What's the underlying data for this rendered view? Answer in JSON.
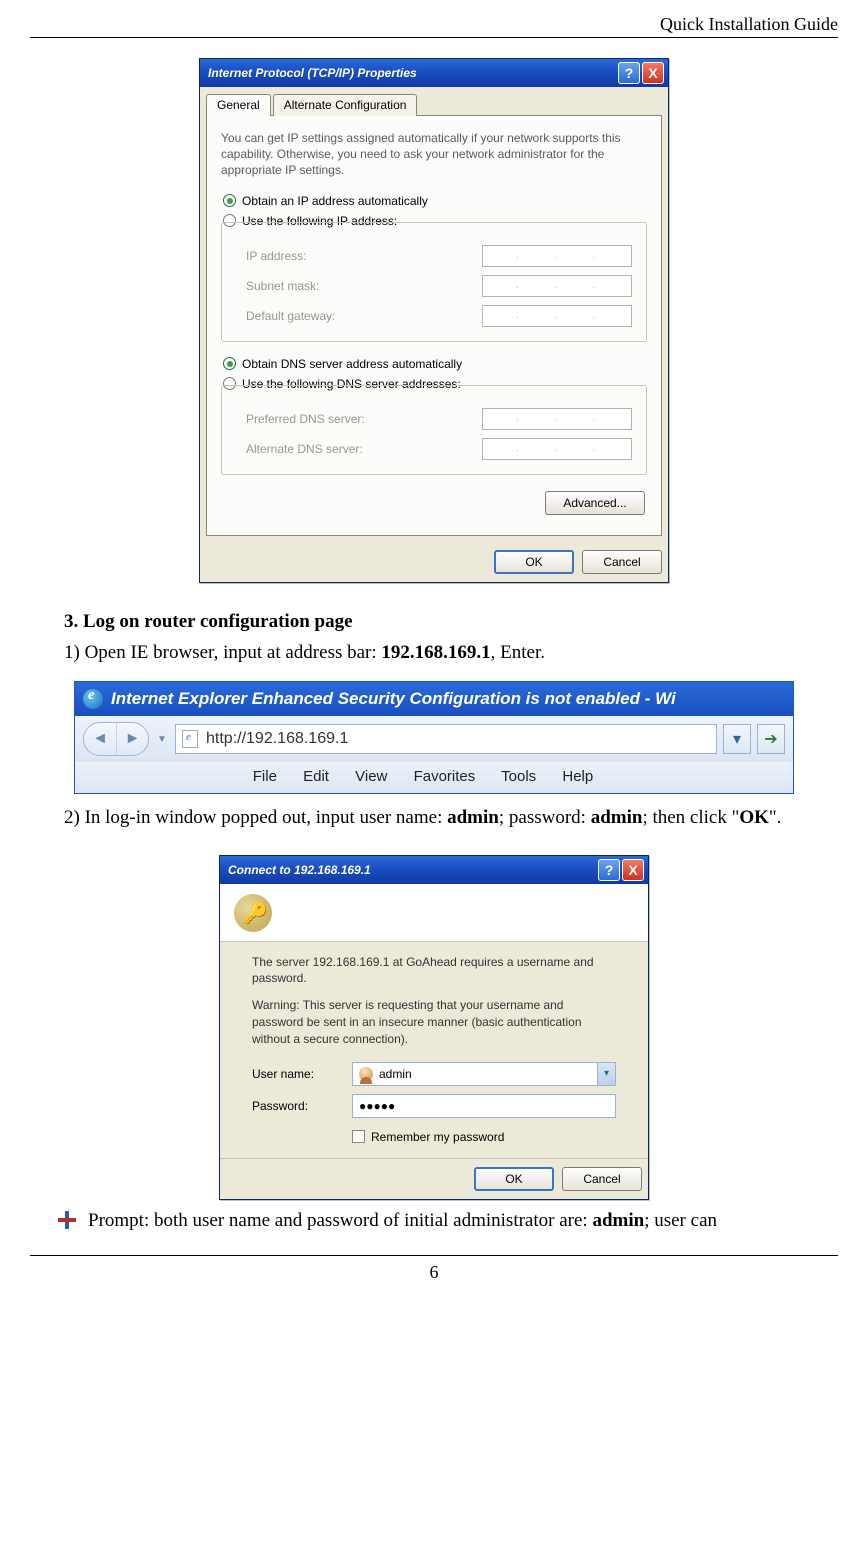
{
  "doc": {
    "header": "Quick Installation Guide",
    "page_number": "6"
  },
  "tcpip_dialog": {
    "title": "Internet Protocol (TCP/IP) Properties",
    "help_btn": "?",
    "close_btn": "X",
    "tabs": {
      "general": "General",
      "alt": "Alternate Configuration"
    },
    "description": "You can get IP settings assigned automatically if your network supports this capability. Otherwise, you need to ask your network administrator for the appropriate IP settings.",
    "radio_obtain_ip": "Obtain an IP address automatically",
    "radio_manual_ip": "Use the following IP address:",
    "lbl_ip": "IP address:",
    "lbl_mask": "Subnet mask:",
    "lbl_gw": "Default gateway:",
    "radio_obtain_dns": "Obtain DNS server address automatically",
    "radio_manual_dns": "Use the following DNS server addresses:",
    "lbl_pref_dns": "Preferred DNS server:",
    "lbl_alt_dns": "Alternate DNS server:",
    "btn_advanced": "Advanced...",
    "btn_ok": "OK",
    "btn_cancel": "Cancel"
  },
  "section": {
    "heading_num": "3.",
    "heading_text": "Log on router configuration page",
    "step1_pre": "1) Open IE browser, input at address bar: ",
    "step1_ip": "192.168.169.1",
    "step1_post": ", Enter.",
    "step2_pre": "2) In log-in window popped out, input user name: ",
    "step2_user": "admin",
    "step2_mid": "; password: ",
    "step2_pass": "admin",
    "step2_post1": "; then click \"",
    "step2_ok": "OK",
    "step2_post2": "\".",
    "prompt_pre": "Prompt: both user name and password of initial administrator are: ",
    "prompt_admin": "admin",
    "prompt_post": "; user can"
  },
  "ie": {
    "title": "Internet Explorer Enhanced Security Configuration is not enabled - Wi",
    "url": "http://192.168.169.1",
    "menu": {
      "file": "File",
      "edit": "Edit",
      "view": "View",
      "fav": "Favorites",
      "tools": "Tools",
      "help": "Help"
    }
  },
  "auth": {
    "title": "Connect to 192.168.169.1",
    "server_msg": "The server 192.168.169.1 at GoAhead requires a username and password.",
    "warning": "Warning: This server is requesting that your username and password be sent in an insecure manner (basic authentication without a secure connection).",
    "lbl_user": "User name:",
    "lbl_pass": "Password:",
    "val_user": "admin",
    "val_pass": "●●●●●",
    "remember": "Remember my password",
    "btn_ok": "OK",
    "btn_cancel": "Cancel",
    "help_btn": "?",
    "close_btn": "X"
  }
}
